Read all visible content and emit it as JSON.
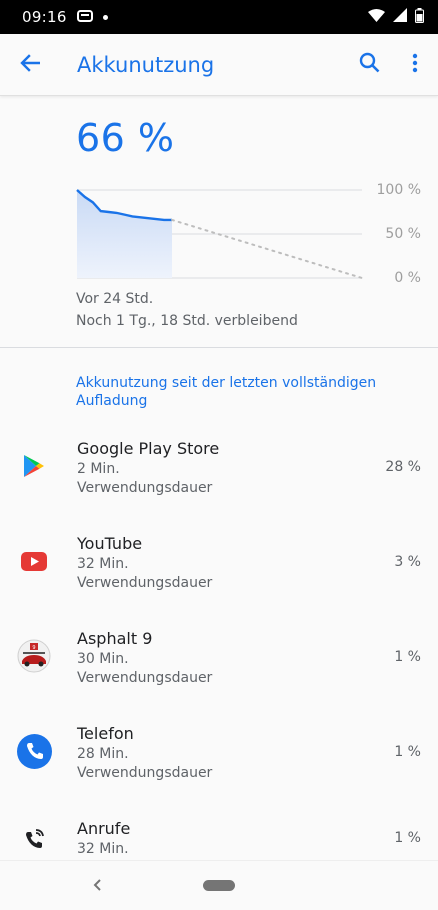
{
  "status_bar": {
    "time": "09:16",
    "icons": [
      "message-icon",
      "dot",
      "wifi-icon",
      "signal-icon",
      "battery-icon"
    ]
  },
  "app_bar": {
    "title": "Akkunutzung",
    "back_icon": "arrow-back-icon",
    "search_icon": "search-icon",
    "menu_icon": "more-vert-icon"
  },
  "battery": {
    "level": "66 %",
    "level_value": 66
  },
  "chart_data": {
    "type": "line",
    "ylim": [
      0,
      100
    ],
    "tick_labels": [
      "100 %",
      "50 %",
      "0 %"
    ],
    "measured": {
      "x_hours": [
        0,
        2,
        4,
        6,
        8,
        10,
        12,
        14,
        16,
        18,
        20,
        22,
        24
      ],
      "y_percent": [
        100,
        92,
        86,
        76,
        75,
        74,
        72,
        70,
        69,
        68,
        67,
        66,
        66
      ]
    },
    "projection": {
      "x_hours": [
        24,
        72
      ],
      "y_percent": [
        66,
        0
      ]
    }
  },
  "summary": {
    "since": "Vor 24 Std.",
    "remaining": "Noch 1 Tg., 18 Std. verbleibend"
  },
  "section_header": "Akkunutzung seit der letzten vollständigen Aufladung",
  "apps": [
    {
      "name": "Google Play Store",
      "time": "2 Min.",
      "sub": "Verwendungsdauer",
      "percent": "28 %",
      "icon": "play-store-icon"
    },
    {
      "name": "YouTube",
      "time": "32 Min.",
      "sub": "Verwendungsdauer",
      "percent": "3 %",
      "icon": "youtube-icon"
    },
    {
      "name": "Asphalt 9",
      "time": "30 Min.",
      "sub": "Verwendungsdauer",
      "percent": "1 %",
      "icon": "asphalt-icon"
    },
    {
      "name": "Telefon",
      "time": "28 Min.",
      "sub": "Verwendungsdauer",
      "percent": "1 %",
      "icon": "phone-icon"
    },
    {
      "name": "Anrufe",
      "time": "32 Min.",
      "sub": "",
      "percent": "1 %",
      "icon": "calls-icon"
    }
  ],
  "nav_bar": {
    "back_icon": "nav-back-icon",
    "home_icon": "nav-home-pill"
  },
  "colors": {
    "accent": "#1a73e8",
    "chart_fill": "#dbe6f7",
    "text_secondary": "#5f6368"
  }
}
